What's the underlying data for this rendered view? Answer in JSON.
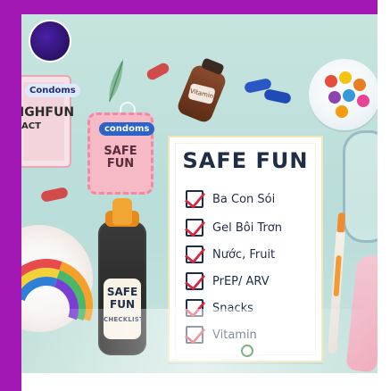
{
  "colors": {
    "frame_accent": "#a318b5",
    "background": "#c7e4df",
    "checkmark": "#d7263d",
    "ink": "#1f2d47"
  },
  "condom_left": {
    "brand": "Condoms",
    "title_fragment": "IGHFUN",
    "subtitle_fragment": "ACT"
  },
  "condom_mid": {
    "brand": "condoms",
    "line1": "SAFE",
    "line2": "FUN"
  },
  "small_bottle": {
    "label": "Vitamin"
  },
  "checklist": {
    "title": "SAFE FUN",
    "items": [
      {
        "label": "Ba Con Sói",
        "checked": true
      },
      {
        "label": "Gel Bôi Trơn",
        "checked": true
      },
      {
        "label": "Nước, Fruit",
        "checked": true
      },
      {
        "label": "PrEP/ ARV",
        "checked": true
      },
      {
        "label": "Snacks",
        "checked": true
      },
      {
        "label": "Vitamin",
        "checked": true
      }
    ]
  },
  "big_bottle": {
    "label_line1": "SAFE",
    "label_line2": "FUN",
    "label_line3": "CHECKLIST"
  },
  "icons": {
    "logo": "logo-icon",
    "leaf": "leaf-icon",
    "bowl": "candy-bowl-icon",
    "glass": "glass-icon",
    "plate": "plate-icon",
    "pen": "pen-icon",
    "spoon": "spoon-icon"
  }
}
